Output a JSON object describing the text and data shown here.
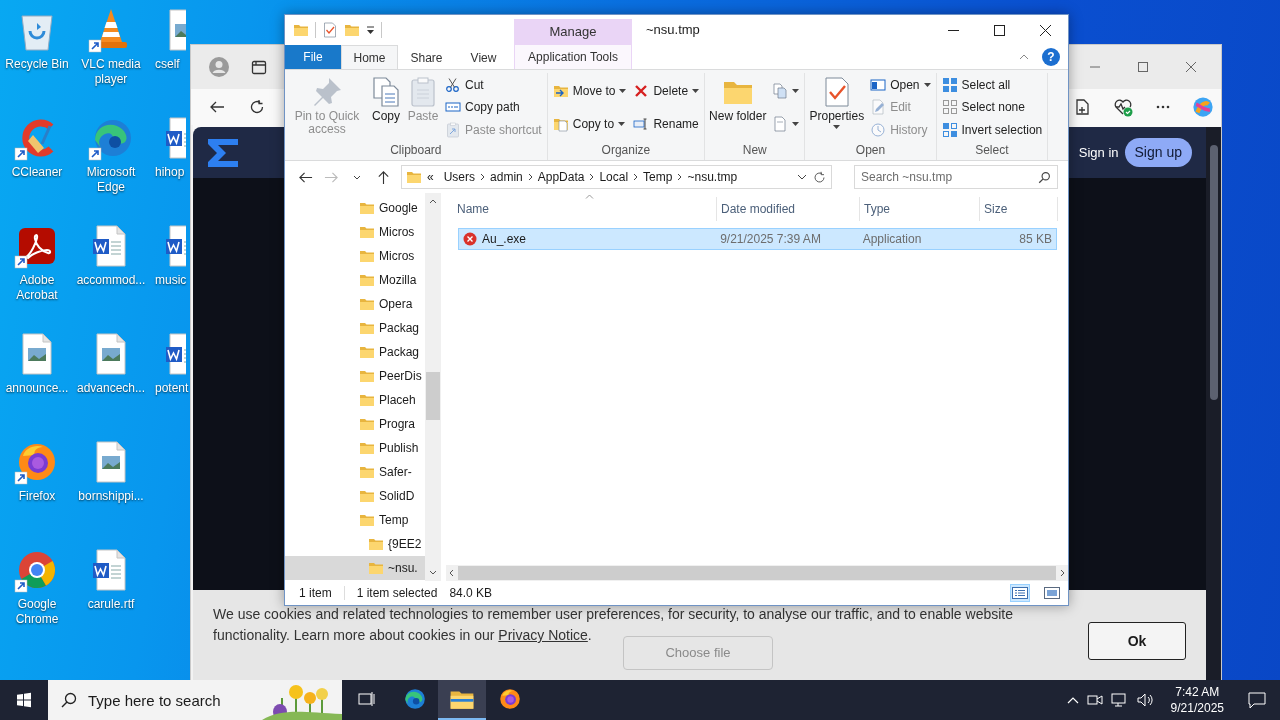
{
  "desktop": {
    "icons": [
      {
        "label": "Recycle Bin",
        "kind": "recycle-bin",
        "shortcut": false
      },
      {
        "label": "CCleaner",
        "kind": "ccleaner",
        "shortcut": true
      },
      {
        "label": "Adobe Acrobat",
        "kind": "acrobat",
        "shortcut": true
      },
      {
        "label": "announce...",
        "kind": "image-file",
        "shortcut": false
      },
      {
        "label": "Firefox",
        "kind": "firefox",
        "shortcut": true
      },
      {
        "label": "Google Chrome",
        "kind": "chrome",
        "shortcut": true
      },
      {
        "label": "VLC media player",
        "kind": "vlc",
        "shortcut": true
      },
      {
        "label": "Microsoft Edge",
        "kind": "edge",
        "shortcut": true
      },
      {
        "label": "accommod...",
        "kind": "word-file",
        "shortcut": false
      },
      {
        "label": "advancech...",
        "kind": "image-file",
        "shortcut": false
      },
      {
        "label": "bornshippi...",
        "kind": "image-file",
        "shortcut": false
      },
      {
        "label": "carule.rtf",
        "kind": "word-file",
        "shortcut": false
      },
      {
        "label": "cself",
        "kind": "image-file",
        "shortcut": false
      },
      {
        "label": "hihop",
        "kind": "word-file",
        "shortcut": false
      },
      {
        "label": "music",
        "kind": "word-file",
        "shortcut": false
      },
      {
        "label": "potent",
        "kind": "word-file",
        "shortcut": false
      }
    ]
  },
  "browser": {
    "header": {
      "sign_in": "Sign in",
      "sign_up": "Sign up"
    },
    "page_button": "Choose file",
    "cookie_banner": {
      "text": "We use cookies and related technologies to remember user preferences, for security, to analyse our traffic, and to enable website functionality. Learn more about cookies in our",
      "link": "Privacy Notice",
      "end": ".",
      "button": "Ok"
    }
  },
  "explorer": {
    "title": "~nsu.tmp",
    "context_group": "Manage",
    "help": "?",
    "tabs": [
      {
        "label": "File",
        "kind": "file",
        "selected": false
      },
      {
        "label": "Home",
        "kind": "tab",
        "selected": true
      },
      {
        "label": "Share",
        "kind": "tab",
        "selected": false
      },
      {
        "label": "View",
        "kind": "tab",
        "selected": false
      },
      {
        "label": "Application Tools",
        "kind": "context",
        "selected": false
      }
    ],
    "ribbon": [
      {
        "label": "Clipboard",
        "columns": [
          {
            "kind": "large",
            "commands": [
              {
                "label": "Pin to Quick access",
                "disabled": true,
                "dropdown": false
              }
            ]
          },
          {
            "kind": "large",
            "commands": [
              {
                "label": "Copy",
                "disabled": false,
                "dropdown": false
              }
            ]
          },
          {
            "kind": "large",
            "commands": [
              {
                "label": "Paste",
                "disabled": true,
                "dropdown": false
              }
            ]
          },
          {
            "kind": "small",
            "commands": [
              {
                "label": "Cut",
                "disabled": false,
                "dropdown": false
              },
              {
                "label": "Copy path",
                "disabled": false,
                "dropdown": false
              },
              {
                "label": "Paste shortcut",
                "disabled": true,
                "dropdown": false
              }
            ]
          }
        ]
      },
      {
        "label": "Organize",
        "columns": [
          {
            "kind": "small",
            "commands": [
              {
                "label": "Move to",
                "disabled": false,
                "dropdown": true
              },
              {
                "label": "Copy to",
                "disabled": false,
                "dropdown": true
              }
            ]
          },
          {
            "kind": "small",
            "commands": [
              {
                "label": "Delete",
                "disabled": false,
                "dropdown": true
              },
              {
                "label": "Rename",
                "disabled": false,
                "dropdown": false
              }
            ]
          }
        ]
      },
      {
        "label": "New",
        "columns": [
          {
            "kind": "large",
            "commands": [
              {
                "label": "New folder",
                "disabled": false,
                "dropdown": false
              }
            ]
          },
          {
            "kind": "small",
            "commands": [
              {
                "disabled": false,
                "dropdown": true
              },
              {
                "disabled": false,
                "dropdown": true
              }
            ]
          }
        ]
      },
      {
        "label": "Open",
        "columns": [
          {
            "kind": "large",
            "commands": [
              {
                "label": "Properties",
                "disabled": false,
                "dropdown": true
              }
            ]
          },
          {
            "kind": "small",
            "commands": [
              {
                "label": "Open",
                "disabled": false,
                "dropdown": true
              },
              {
                "label": "Edit",
                "disabled": true,
                "dropdown": false
              },
              {
                "label": "History",
                "disabled": true,
                "dropdown": false
              }
            ]
          }
        ]
      },
      {
        "label": "Select",
        "columns": [
          {
            "kind": "small",
            "commands": [
              {
                "label": "Select all",
                "disabled": false,
                "dropdown": false
              },
              {
                "label": "Select none",
                "disabled": false,
                "dropdown": false
              },
              {
                "label": "Invert selection",
                "disabled": false,
                "dropdown": false
              }
            ]
          }
        ]
      }
    ],
    "address": {
      "overflow": "«",
      "path": [
        "Users",
        "admin",
        "AppData",
        "Local",
        "Temp",
        "~nsu.tmp"
      ]
    },
    "search_placeholder": "Search ~nsu.tmp",
    "nav_tree": [
      {
        "label": "Google",
        "selected": false
      },
      {
        "label": "Micros",
        "selected": false
      },
      {
        "label": "Micros",
        "selected": false
      },
      {
        "label": "Mozilla",
        "selected": false
      },
      {
        "label": "Opera",
        "selected": false
      },
      {
        "label": "Packag",
        "selected": false
      },
      {
        "label": "Packag",
        "selected": false
      },
      {
        "label": "PeerDis",
        "selected": false
      },
      {
        "label": "Placeh",
        "selected": false
      },
      {
        "label": "Progra",
        "selected": false
      },
      {
        "label": "Publish",
        "selected": false
      },
      {
        "label": "Safer-",
        "selected": false
      },
      {
        "label": "SolidD",
        "selected": false
      },
      {
        "label": "Temp",
        "selected": false,
        "children": [
          {
            "label": "{9EE2",
            "selected": false
          },
          {
            "label": "~nsu.",
            "selected": true
          }
        ]
      }
    ],
    "columns": [
      {
        "label": "Name",
        "sorted": true
      },
      {
        "label": "Date modified",
        "sorted": false
      },
      {
        "label": "Type",
        "sorted": false
      },
      {
        "label": "Size",
        "sorted": false
      }
    ],
    "files": [
      {
        "name": "Au_.exe",
        "date": "9/21/2025 7:39 AM",
        "type": "Application",
        "size": "85 KB",
        "selected": true
      }
    ],
    "status": {
      "count": "1 item",
      "selection": "1 item selected",
      "size": "84.0 KB"
    },
    "views": [
      {
        "kind": "details",
        "selected": true
      },
      {
        "kind": "large-icons",
        "selected": false
      }
    ]
  },
  "taskbar": {
    "search_placeholder": "Type here to search",
    "apps": [
      {
        "kind": "task-view",
        "selected": false
      },
      {
        "kind": "edge",
        "selected": false
      },
      {
        "kind": "explorer",
        "selected": true
      },
      {
        "kind": "firefox",
        "selected": false
      }
    ],
    "time": "7:42 AM",
    "date": "9/21/2025"
  }
}
